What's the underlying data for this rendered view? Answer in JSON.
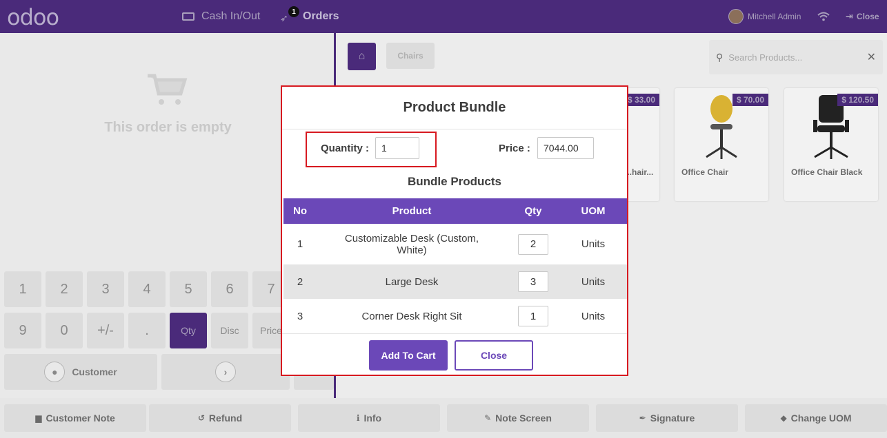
{
  "topbar": {
    "logo": "odoo",
    "cash_label": "Cash In/Out",
    "orders_label": "Orders",
    "orders_badge": "1",
    "user_name": "Mitchell Admin",
    "close_label": "Close"
  },
  "order": {
    "empty_text": "This order is empty"
  },
  "numpad": {
    "row1": [
      "1",
      "2",
      "3",
      "4",
      "5",
      "6",
      "7"
    ],
    "row2": [
      "9",
      "0",
      "+/-",
      ".",
      "Qty",
      "Disc",
      "Price"
    ],
    "customer_label": "Customer"
  },
  "products": {
    "category": "Chairs",
    "search_placeholder": "Search Products...",
    "items": [
      {
        "name": "...hair...",
        "price": "$ 33.00"
      },
      {
        "name": "Office Chair",
        "price": "$ 70.00"
      },
      {
        "name": "Office Chair Black",
        "price": "$ 120.50"
      }
    ]
  },
  "bottom_bar": {
    "customer_note": "Customer Note",
    "refund": "Refund",
    "info": "Info",
    "note_screen": "Note Screen",
    "signature": "Signature",
    "change_uom": "Change UOM"
  },
  "modal": {
    "title": "Product Bundle",
    "quantity_label": "Quantity :",
    "quantity_value": "1",
    "price_label": "Price :",
    "price_value": "7044.00",
    "subtitle": "Bundle Products",
    "columns": [
      "No",
      "Product",
      "Qty",
      "UOM"
    ],
    "rows": [
      {
        "no": "1",
        "product": "Customizable Desk (Custom, White)",
        "qty": "2",
        "uom": "Units"
      },
      {
        "no": "2",
        "product": "Large Desk",
        "qty": "3",
        "uom": "Units"
      },
      {
        "no": "3",
        "product": "Corner Desk Right Sit",
        "qty": "1",
        "uom": "Units"
      }
    ],
    "add_button": "Add To Cart",
    "close_button": "Close"
  },
  "colors": {
    "brand": "#4a2a7a",
    "accent": "#6b48b8",
    "highlight": "#d71920"
  }
}
